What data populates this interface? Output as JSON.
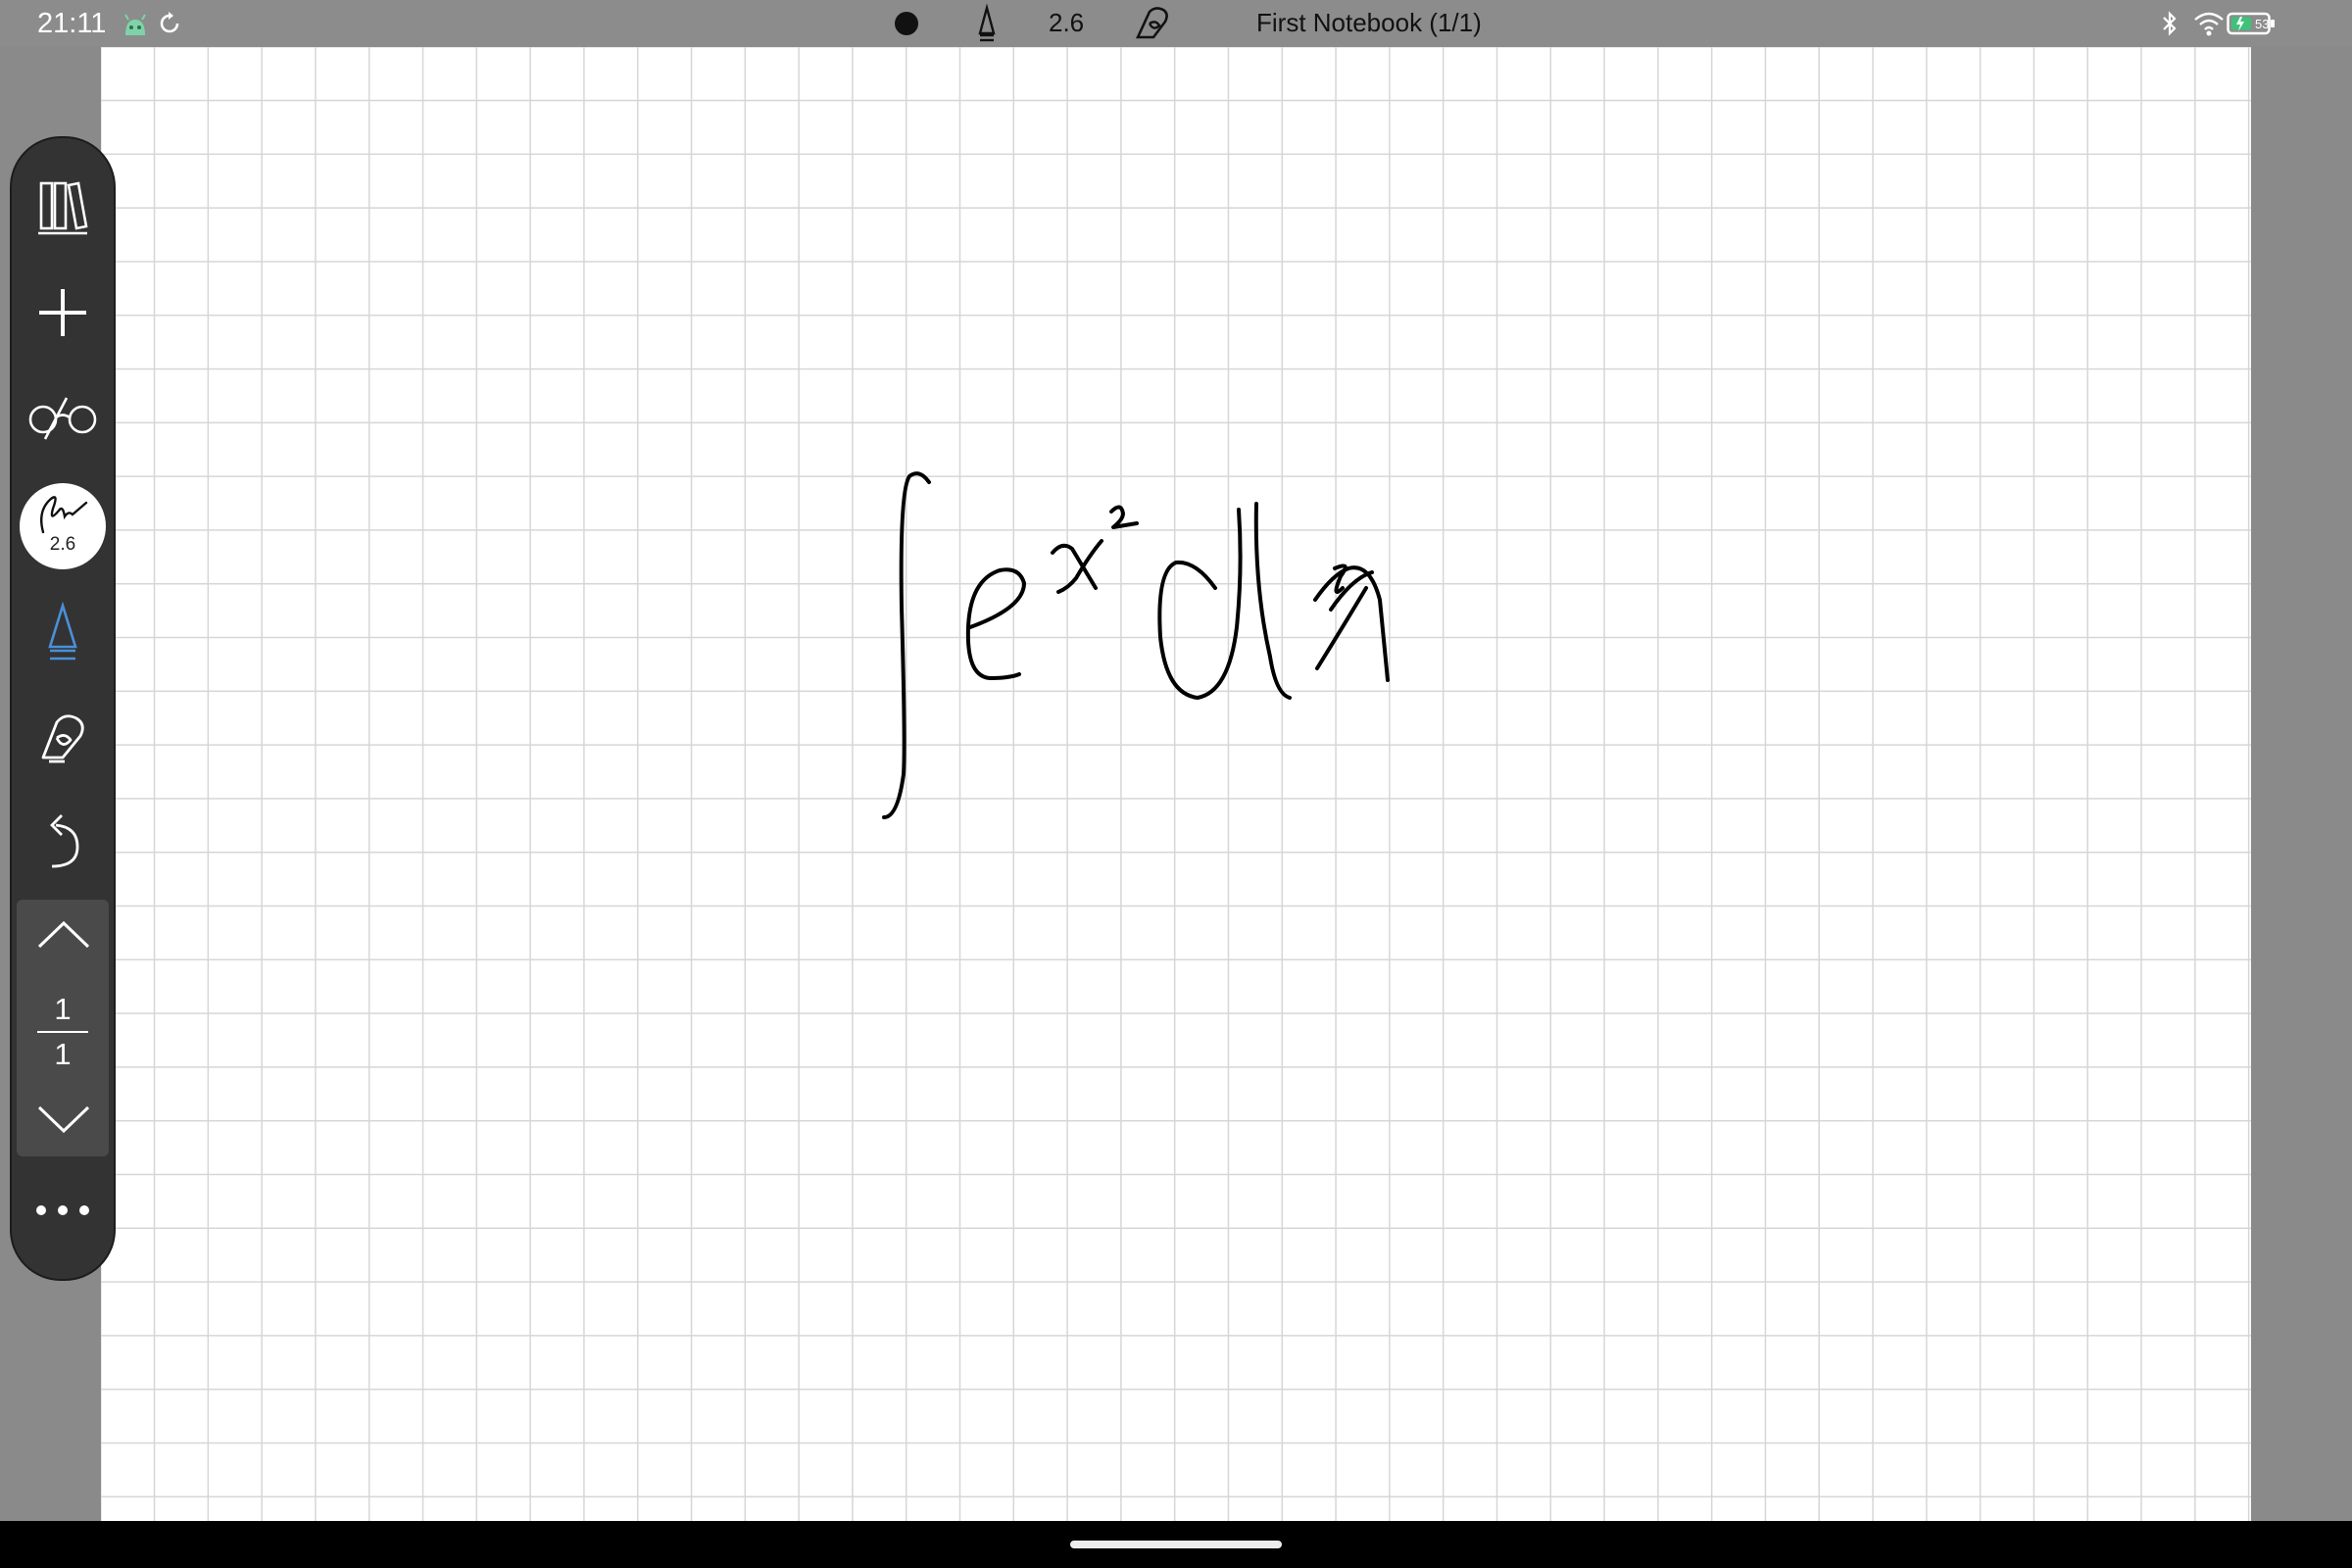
{
  "status_bar": {
    "time": "21:11",
    "battery_level": "53",
    "icons": [
      "android-debug-icon",
      "sync-icon",
      "bluetooth-icon",
      "wifi-icon",
      "battery-charging-icon"
    ]
  },
  "top_bar": {
    "pen_color": "#000000",
    "pen_size": "2.6",
    "notebook_title": "First Notebook (1/1)"
  },
  "toolbar": {
    "buttons": [
      "library-icon",
      "add-icon",
      "read-mode-icon",
      "pen-icon",
      "pen-tip-icon",
      "eraser-hand-icon",
      "undo-icon",
      "page-up-icon",
      "page-down-icon",
      "more-icon"
    ],
    "pen_size": "2.6",
    "current_page": "1",
    "total_pages": "1"
  },
  "colors": {
    "accent": "#4a90d9",
    "toolbar_bg": "#333333",
    "status_bar_bg": "#8c8c8c",
    "grid_line": "#d6d6d6"
  }
}
